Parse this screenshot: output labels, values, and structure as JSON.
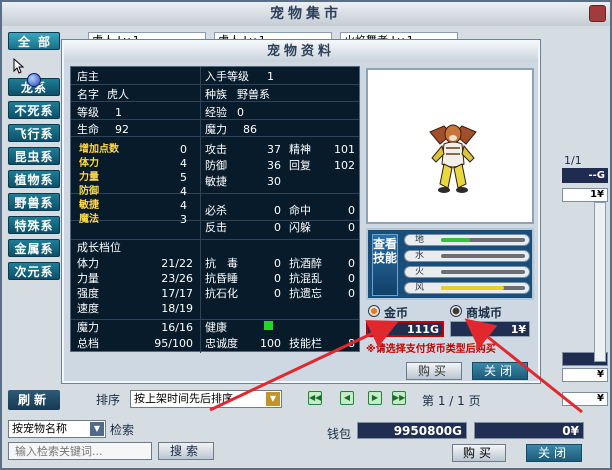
{
  "market": {
    "title": "宠物集市",
    "categories": [
      "全部",
      "龙系",
      "不死系",
      "飞行系",
      "昆虫系",
      "植物系",
      "野兽系",
      "特殊系",
      "金属系",
      "次元系"
    ],
    "bg_rows": [
      "虎人 Lv.1",
      "虎人 Lv.1",
      "火焰舞者 Lv.1"
    ],
    "right_page": "1/1",
    "right_values": [
      "--G",
      "1¥",
      "G",
      "¥",
      "¥"
    ],
    "refresh": "刷新",
    "search_mode": "按宠物名称",
    "search_label": "检索",
    "search_placeholder": "输入检索关键词...",
    "search_button": "搜索",
    "sort_label": "排序",
    "sort_value": "按上架时间先后排序",
    "page_info": "第 1 / 1 页",
    "wallet_label": "钱包",
    "wallet_gold": "9950800G",
    "wallet_mall": "0¥",
    "buy": "购买",
    "close": "关闭"
  },
  "pet": {
    "title": "宠物资料",
    "owner_label": "店主",
    "entry_level_label": "入手等级",
    "entry_level": "1",
    "name_label": "名字",
    "name": "虎人",
    "race_label": "种族",
    "race": "野兽系",
    "level_label": "等级",
    "level": "1",
    "exp_label": "经验",
    "exp": "0",
    "hp_label": "生命",
    "hp": "92",
    "mp_label": "魔力",
    "mp": "86",
    "bonus_label": "增加点数",
    "bonus": "0",
    "stats_left": [
      {
        "label": "体力",
        "value": "4"
      },
      {
        "label": "力量",
        "value": "5"
      },
      {
        "label": "防御",
        "value": "4"
      },
      {
        "label": "敏捷",
        "value": "4"
      },
      {
        "label": "魔法",
        "value": "3"
      }
    ],
    "attack_label": "攻击",
    "attack": "37",
    "spirit_label": "精神",
    "spirit": "101",
    "defense_label": "防御",
    "defense": "36",
    "recover_label": "回复",
    "recover": "102",
    "agility_label": "敏捷",
    "agility": "30",
    "crit_label": "必杀",
    "crit": "0",
    "hit_label": "命中",
    "hit": "0",
    "counter_label": "反击",
    "counter": "0",
    "dodge_label": "闪躲",
    "dodge": "0",
    "growth_label": "成长档位",
    "growth": [
      {
        "label": "体力",
        "value": "21/22"
      },
      {
        "label": "力量",
        "value": "23/26"
      },
      {
        "label": "强度",
        "value": "17/17"
      },
      {
        "label": "速度",
        "value": "18/19"
      },
      {
        "label": "魔力",
        "value": "16/16"
      },
      {
        "label": "总档",
        "value": "95/100"
      }
    ],
    "resists": [
      {
        "label": "抗　毒",
        "value": "0"
      },
      {
        "label": "抗酒醉",
        "value": "0"
      },
      {
        "label": "抗昏睡",
        "value": "0"
      },
      {
        "label": "抗混乱",
        "value": "0"
      },
      {
        "label": "抗石化",
        "value": "0"
      },
      {
        "label": "抗遗忘",
        "value": "0"
      }
    ],
    "health_label": "健康",
    "loyalty_label": "忠诚度",
    "loyalty": "100",
    "skill_slots_label": "技能栏",
    "skill_slots": "8",
    "view_skills": "查看技能",
    "elements": [
      {
        "name": "地",
        "fill": 0.35,
        "color": "#38c13e"
      },
      {
        "name": "水",
        "fill": 0.0,
        "color": "#3a7bd5"
      },
      {
        "name": "火",
        "fill": 0.0,
        "color": "#d54a2a"
      },
      {
        "name": "风",
        "fill": 0.75,
        "color": "#e8d02a"
      }
    ],
    "pay_gold_label": "金币",
    "pay_mall_label": "商城币",
    "price_gold": "111G",
    "price_mall": "1¥",
    "pay_note": "※请选择支付货币类型后购买",
    "buy": "购买",
    "close": "关闭"
  },
  "colors": {
    "accent": "#1d5b78",
    "highlight": "#c40000",
    "panel": "#071b2b"
  }
}
